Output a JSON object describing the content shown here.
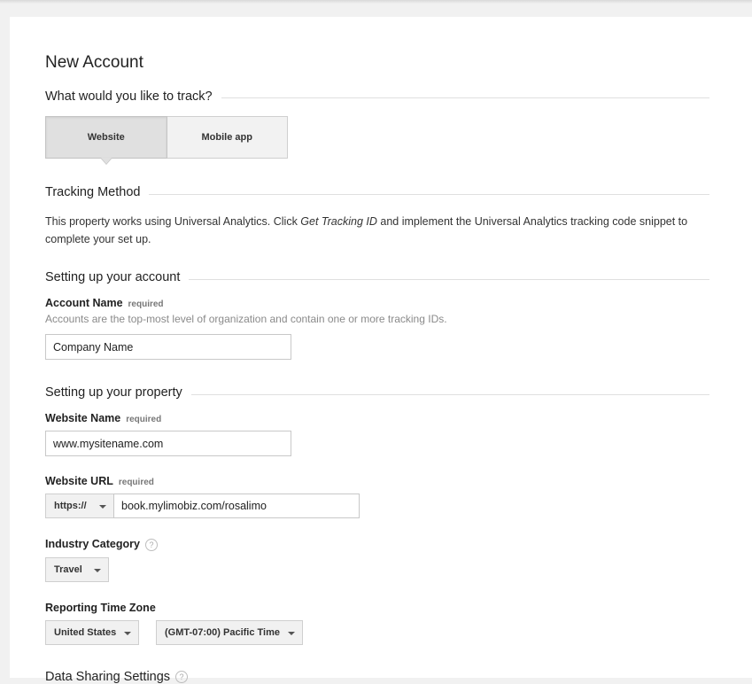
{
  "page": {
    "title": "New Account"
  },
  "track": {
    "heading": "What would you like to track?",
    "options": [
      {
        "label": "Website",
        "selected": true
      },
      {
        "label": "Mobile app",
        "selected": false
      }
    ]
  },
  "tracking_method": {
    "heading": "Tracking Method",
    "text_before": "This property works using Universal Analytics. Click ",
    "text_emphasis": "Get Tracking ID",
    "text_after": " and implement the Universal Analytics tracking code snippet to complete your set up."
  },
  "account": {
    "heading": "Setting up your account",
    "name_label": "Account Name",
    "required_label": "required",
    "help": "Accounts are the top-most level of organization and contain one or more tracking IDs.",
    "name_value": "Company Name"
  },
  "property": {
    "heading": "Setting up your property",
    "website_name_label": "Website Name",
    "website_name_value": "www.mysitename.com",
    "website_url_label": "Website URL",
    "protocol_value": "https://",
    "url_value": "book.mylimobiz.com/rosalimo",
    "industry_label": "Industry Category",
    "industry_value": "Travel",
    "timezone_label": "Reporting Time Zone",
    "country_value": "United States",
    "timezone_value": "(GMT-07:00) Pacific Time",
    "help_icon": "?"
  },
  "data_sharing": {
    "heading": "Data Sharing Settings"
  }
}
